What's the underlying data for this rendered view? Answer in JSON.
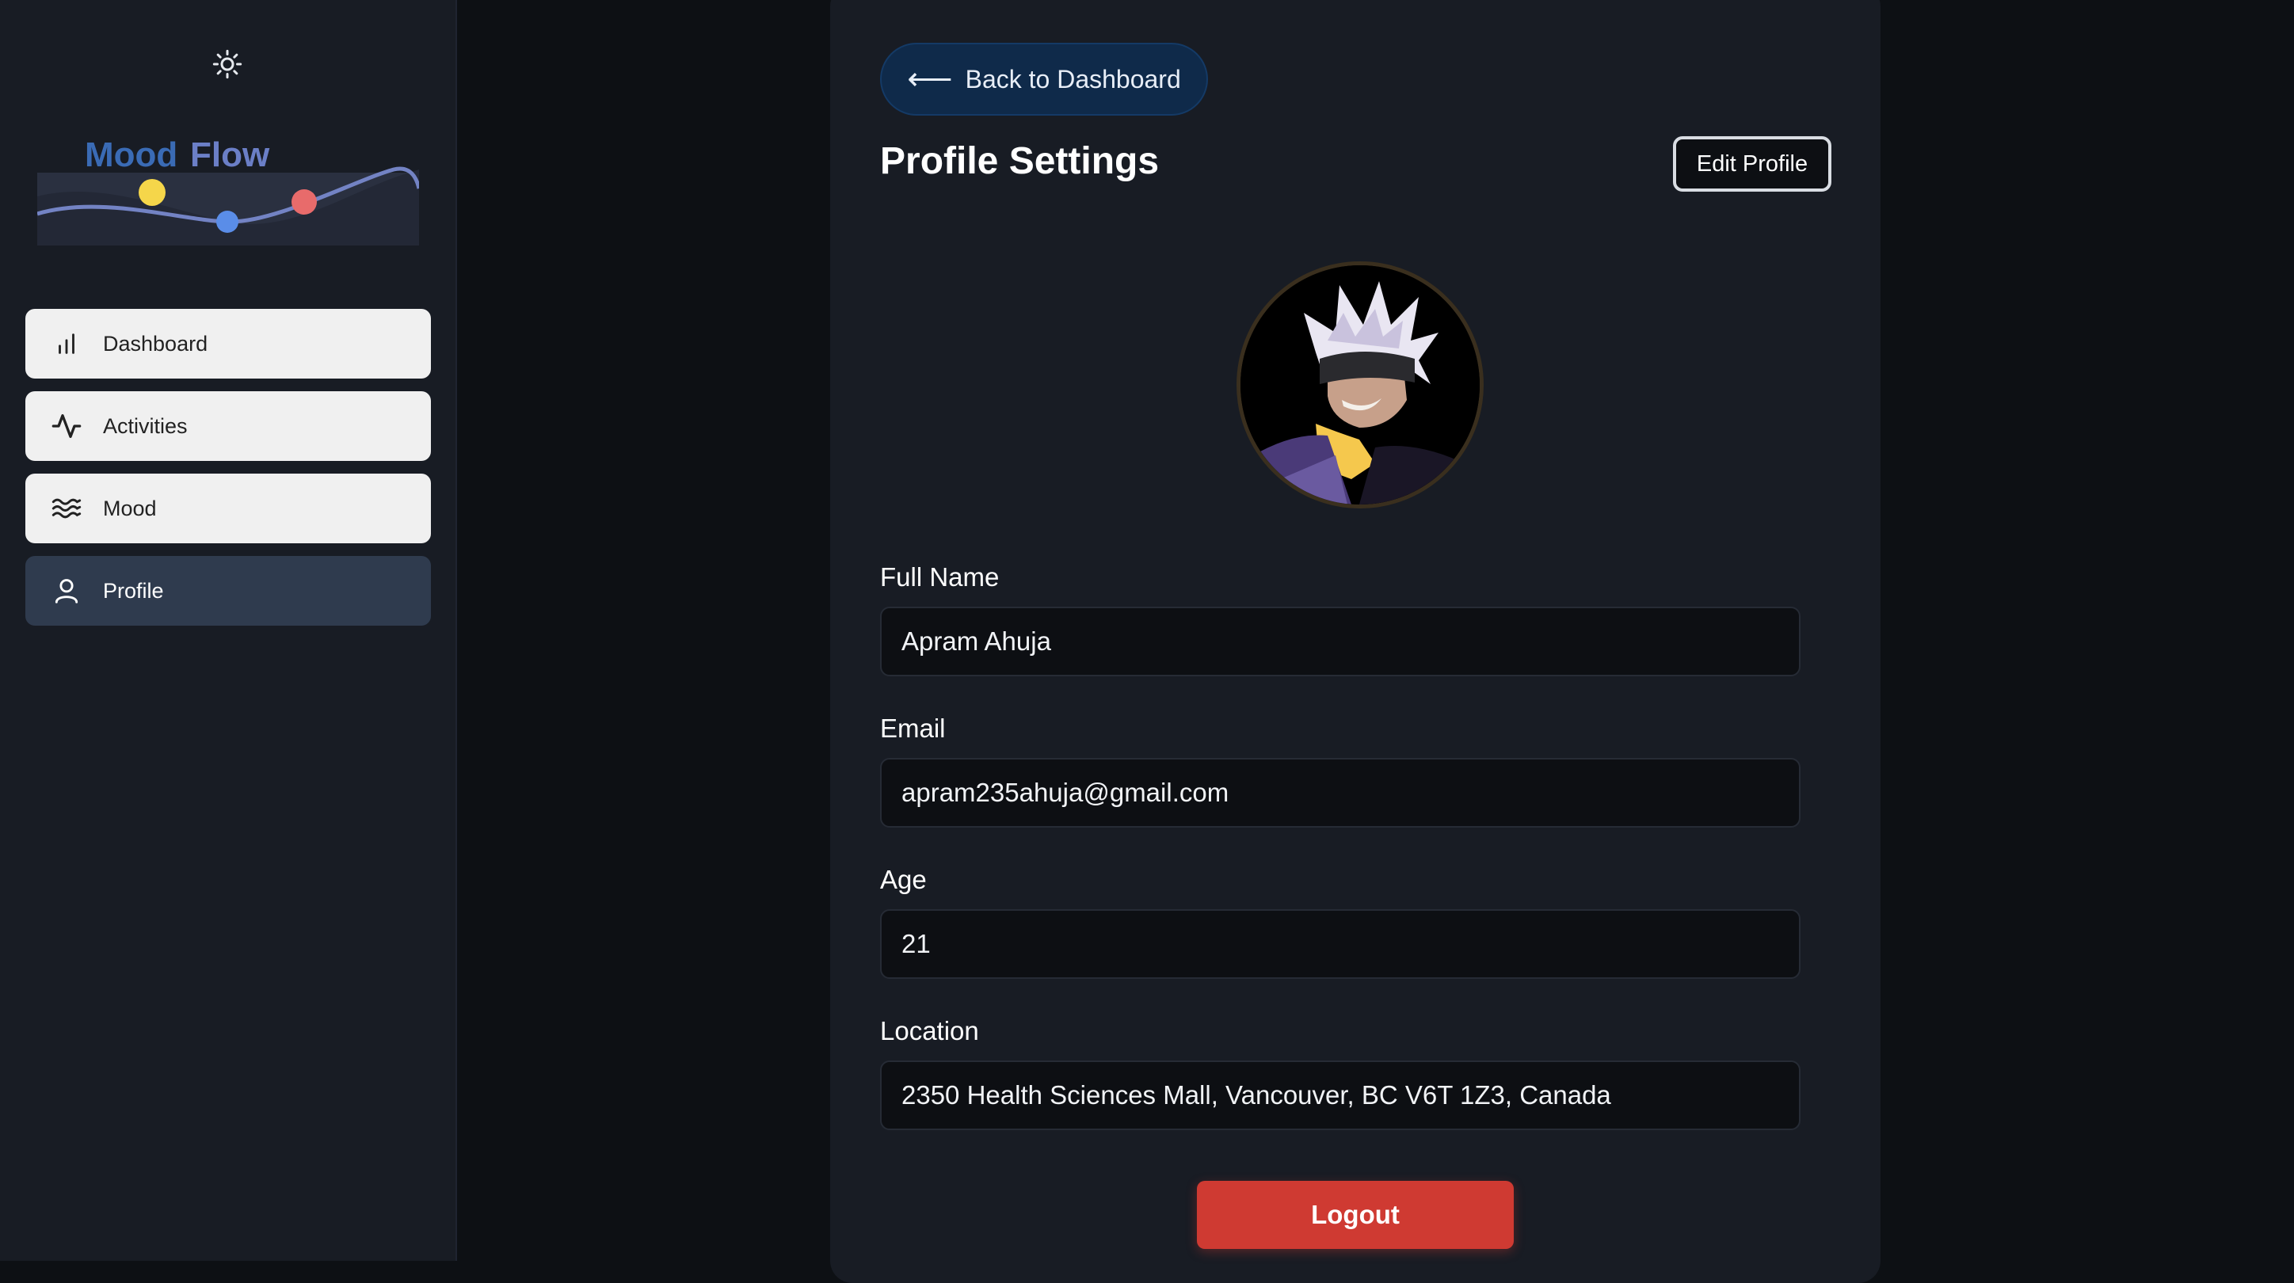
{
  "app": {
    "logo_word1": "Mood",
    "logo_word2": "Flow"
  },
  "sidebar": {
    "theme_icon": "sun-icon",
    "items": [
      {
        "label": "Dashboard",
        "icon": "bar-chart-icon",
        "active": false
      },
      {
        "label": "Activities",
        "icon": "activity-icon",
        "active": false
      },
      {
        "label": "Mood",
        "icon": "waves-icon",
        "active": false
      },
      {
        "label": "Profile",
        "icon": "user-icon",
        "active": true
      }
    ]
  },
  "header": {
    "back_label": "Back to Dashboard",
    "back_icon": "arrow-left-icon",
    "title": "Profile Settings",
    "edit_label": "Edit Profile"
  },
  "profile": {
    "fields": [
      {
        "label": "Full Name",
        "value": "Apram Ahuja"
      },
      {
        "label": "Email",
        "value": "apram235ahuja@gmail.com"
      },
      {
        "label": "Age",
        "value": "21"
      },
      {
        "label": "Location",
        "value": "2350 Health Sciences Mall, Vancouver, BC V6T 1Z3, Canada"
      }
    ],
    "logout_label": "Logout"
  },
  "colors": {
    "accent_blue": "#0f2a4a",
    "logout_red": "#cf3a32",
    "active_nav": "#2f3b4e"
  }
}
